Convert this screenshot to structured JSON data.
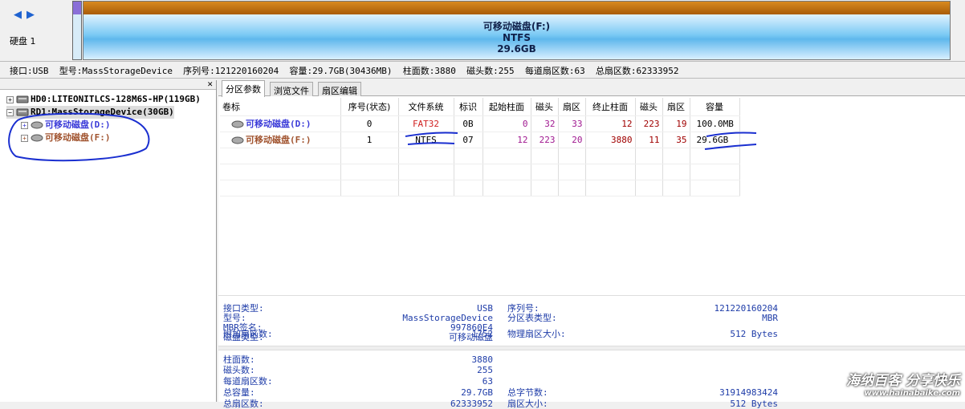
{
  "disk_map": {
    "disk_label": "硬盘 1",
    "partition_name": "可移动磁盘(F:)",
    "partition_fs": "NTFS",
    "partition_size": "29.6GB"
  },
  "info_bar": "接口:USB  型号:MassStorageDevice  序列号:121220160204  容量:29.7GB(30436MB)  柱面数:3880  磁头数:255  每道扇区数:63  总扇区数:62333952",
  "tree": {
    "items": [
      {
        "label": "HD0:LITEONITLCS-128M6S-HP(119GB)"
      },
      {
        "label": "RD1:MassStorageDevice(30GB)"
      },
      {
        "label": "可移动磁盘(D:)"
      },
      {
        "label": "可移动磁盘(F:)"
      }
    ]
  },
  "tabs": [
    "分区参数",
    "浏览文件",
    "扇区编辑"
  ],
  "table": {
    "headers": [
      "卷标",
      "序号(状态)",
      "文件系统",
      "标识",
      "起始柱面",
      "磁头",
      "扇区",
      "终止柱面",
      "磁头",
      "扇区",
      "容量"
    ],
    "rows": [
      [
        "可移动磁盘(D:)",
        "0",
        "FAT32",
        "0B",
        "0",
        "32",
        "33",
        "12",
        "223",
        "19",
        "100.0MB"
      ],
      [
        "可移动磁盘(F:)",
        "1",
        "NTFS",
        "07",
        "12",
        "223",
        "20",
        "3880",
        "11",
        "35",
        "29.6GB"
      ]
    ]
  },
  "details": {
    "interface_type_label": "接口类型:",
    "interface_type": "USB",
    "model_label": "型号:",
    "model": "MassStorageDevice",
    "mbr_sig_label": "MBR签名:",
    "mbr_sig": "997860E4",
    "disk_type_label": "磁盘类型:",
    "disk_type": "可移动磁盘",
    "serial_label": "序列号:",
    "serial": "121220160204",
    "ptable_label": "分区表类型:",
    "ptable": "MBR",
    "cyl_label": "柱面数:",
    "cyl": "3880",
    "heads_label": "磁头数:",
    "heads": "255",
    "spt_label": "每道扇区数:",
    "spt": "63",
    "cap_label": "总容量:",
    "cap": "29.7GB",
    "total_sec_label": "总扇区数:",
    "total_sec": "62333952",
    "extra_sec_label": "附加扇区数:",
    "extra_sec": "1752",
    "total_bytes_label": "总字节数:",
    "total_bytes": "31914983424",
    "sector_size_label": "扇区大小:",
    "sector_size": "512 Bytes",
    "phys_sector_label": "物理扇区大小:",
    "phys_sector": "512 Bytes"
  },
  "watermark": {
    "line1": "海纳百客 分享快乐",
    "line2": "www.hainabaike.com"
  },
  "colors": {
    "fat32": "#d02020",
    "partition_name_d": "#3a3ad8",
    "partition_name_f": "#a0522d",
    "numbers": "#a01890",
    "annotation": "#1a2fd0"
  }
}
